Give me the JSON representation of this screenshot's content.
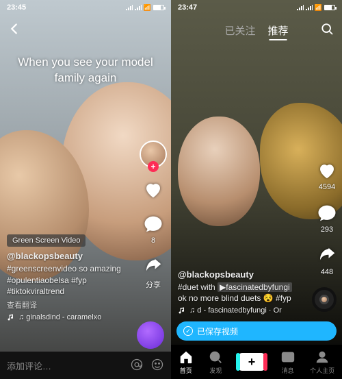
{
  "left": {
    "status": {
      "time": "23:45"
    },
    "caption_line1": "When you see your model",
    "caption_line2": "family again",
    "effect_label": "Green Screen Video",
    "username": "@blackopsbeauty",
    "description": "#greenscreenvideo   so amazing #opulentiaobelsa #fyp #tiktokviraltrend",
    "see_translation": "查看翻译",
    "music": "♫ ginalsdind - caramelxo",
    "actions": {
      "likes": "",
      "comments": "8",
      "share_label": "分享"
    },
    "comment_placeholder": "添加评论…"
  },
  "right": {
    "status": {
      "time": "23:47"
    },
    "tabs": {
      "following": "已关注",
      "for_you": "推荐"
    },
    "username": "@blackopsbeauty",
    "description_pre": "#duet with ",
    "description_handle": "▶fascinatedbyfungi",
    "description_post": " ok no more blind duets 😵 #fyp",
    "music": "♫ d - fascinatedbyfungi · Or",
    "actions": {
      "likes": "4594",
      "comments": "293",
      "shares": "448"
    },
    "save_banner": "已保存视频",
    "tabbar": {
      "home": "首页",
      "discover": "发现",
      "inbox": "消息",
      "profile": "个人主页"
    }
  }
}
